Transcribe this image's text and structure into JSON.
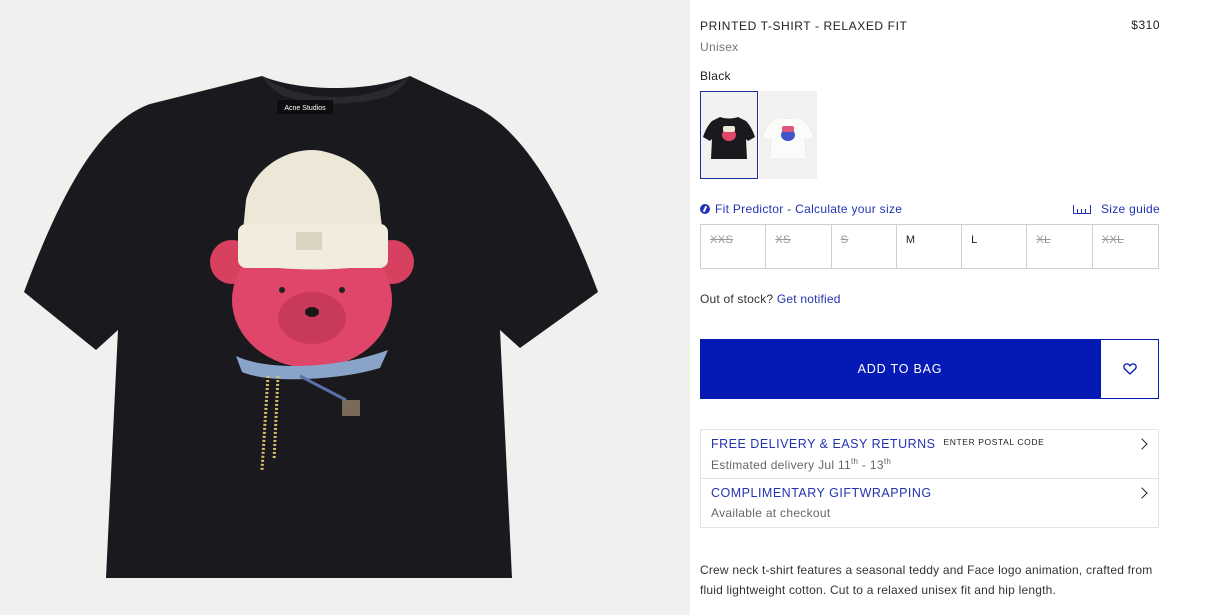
{
  "product": {
    "title": "PRINTED T-SHIRT - RELAXED FIT",
    "price": "$310",
    "gender": "Unisex",
    "color_name": "Black",
    "label_text": "Acne Studios"
  },
  "swatches": [
    {
      "color": "#1a1a1e",
      "selected": true
    },
    {
      "color": "#f4f4f2",
      "selected": false
    }
  ],
  "fit": {
    "fit_predictor_label": "Fit Predictor - Calculate your size",
    "size_guide_label": "Size guide",
    "fit_icon": "fit-predictor-icon",
    "ruler_icon": "ruler-icon"
  },
  "sizes": [
    {
      "label": "XXS",
      "available": false
    },
    {
      "label": "XS",
      "available": false
    },
    {
      "label": "S",
      "available": false
    },
    {
      "label": "M",
      "available": true
    },
    {
      "label": "L",
      "available": true
    },
    {
      "label": "XL",
      "available": false
    },
    {
      "label": "XXL",
      "available": false
    }
  ],
  "stock": {
    "question": "Out of stock?",
    "notify_link": "Get notified"
  },
  "cart": {
    "add_to_bag_label": "ADD TO BAG",
    "wishlist_icon": "heart-icon"
  },
  "delivery": {
    "title": "FREE DELIVERY & EASY RETURNS",
    "postal_label": "ENTER POSTAL CODE",
    "estimate_prefix": "Estimated delivery Jul 11",
    "estimate_sup1": "th",
    "estimate_mid": " - 13",
    "estimate_sup2": "th"
  },
  "gift": {
    "title": "COMPLIMENTARY GIFTWRAPPING",
    "subtitle": "Available at checkout"
  },
  "description": "Crew neck t-shirt features a seasonal teddy and Face logo animation, crafted from fluid lightweight cotton. Cut to a relaxed unisex fit and hip length.",
  "colors": {
    "accent": "#0519b4",
    "link": "#2233b0",
    "shirt": "#1a1a1e",
    "bear": "#e0466a",
    "beanie": "#ece7d6"
  }
}
